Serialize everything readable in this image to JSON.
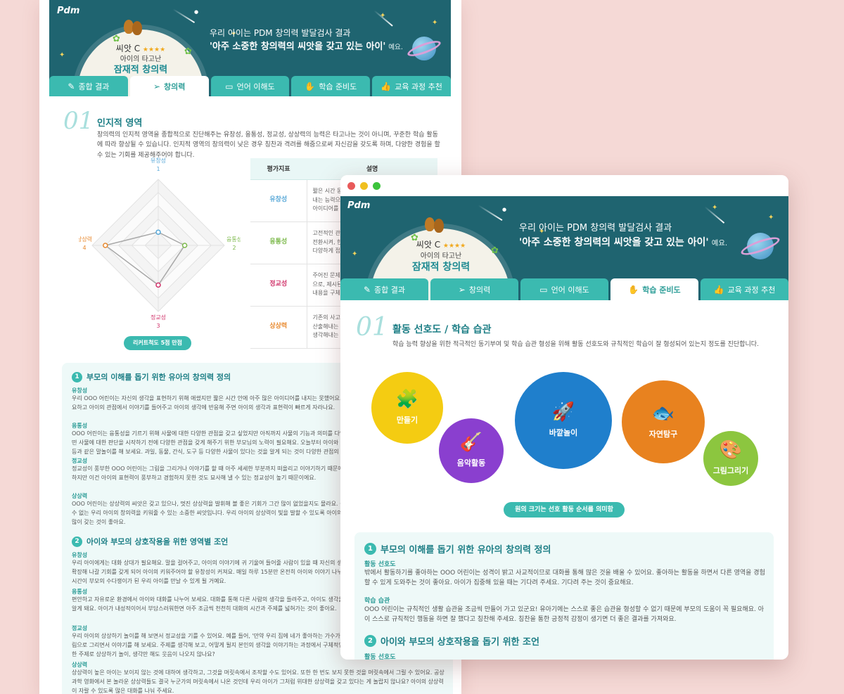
{
  "brand": {
    "logo": "Pdm"
  },
  "colors": {
    "teal_dark": "#1f6470",
    "teal": "#3bbab0",
    "accent": "#1e7f86",
    "bg": "#f5d9d6"
  },
  "banner": {
    "grade": "씨앗 C",
    "stars": "★★★★",
    "grade_sub": "아이의 타고난",
    "grade_main": "잠재적 창의력",
    "line1": "우리 아이는 PDM 창의력 발달검사 결과",
    "line2": "'아주 소중한 창의력의 씨앗을 갖고 있는 아이'",
    "line2_suffix": "예요."
  },
  "tabs": [
    {
      "label": "종합 결과",
      "icon": "edit-icon"
    },
    {
      "label": "창의력",
      "icon": "send-icon"
    },
    {
      "label": "언어 이해도",
      "icon": "chat-icon"
    },
    {
      "label": "학습 준비도",
      "icon": "hand-icon"
    },
    {
      "label": "교육 과정 추천",
      "icon": "thumbs-up-icon"
    }
  ],
  "back": {
    "active_tab": 1,
    "section_num": "01",
    "section_title": "인지적 영역",
    "section_desc": "창의력의 인지적 영역을 종합적으로 진단해주는 유창성, 융통성, 정교성, 상상력의 능력은 타고나는 것이 아니며, 꾸준한 학습 활동에 따라 향상될 수 있습니다. 인지적 영역의 창의력이 낮은 경우 칭찬과 격려를 해줌으로써 자신감을 갖도록 하며, 다양한 경험을 할 수 있는 기회를 제공해주어야 합니다.",
    "radar": {
      "top": {
        "name": "유창성",
        "value": "1"
      },
      "right": {
        "name": "융통성",
        "value": "2"
      },
      "bottom": {
        "name": "정교성",
        "value": "3"
      },
      "left": {
        "name": "상상력",
        "value": "4"
      },
      "scale_max": 5,
      "scores": [
        1,
        2,
        3,
        4
      ]
    },
    "radar_pill": "리커트척도 5점 만점",
    "table": {
      "headers": [
        "평가지표",
        "설명"
      ],
      "rows": [
        {
          "k": "유창성",
          "t": "짧은 시간 동안 가능한 한 많은 아이디어를 산출해내는 능력으로 주제에 맞는 것으로 주제에 관련된 아이디어를 산출해내는 능력"
        },
        {
          "k": "융통성",
          "t": "고전적인 관점에서 벗어나 다양한 방향으로 사고를 전환시켜, 한 가지 방법으로 접근하는 것이 아니라 다양하게 접근하여 아이디어를 산출하는 능력"
        },
        {
          "k": "정교성",
          "t": "주어진 문제를 세밀하게 관찰하여 다듬어 가는 것으로, 제시된 의미를 명확하게 하기 위해 세부적인 내용을 구체화하거나 보완하고 정리하는 능력"
        },
        {
          "k": "상상력",
          "t": "기존의 사고에서 벗어나 새롭고 독특한 아이디어를 산출해내는 능력으로 이전에 경험해보지 못한 것을 생각해내는 능력이나 새로운 것을 만드는 능력"
        }
      ],
      "key_colors": [
        "#5aa9d8",
        "#7cb94b",
        "#d0336a",
        "#e8892e"
      ]
    },
    "advice1": {
      "num": "1",
      "title": "부모의 이해를 돕기 위한 유아의 창의력 정의",
      "items": [
        {
          "h": "유창성",
          "t": "우리 OOO 어린이는 자신의 생각을 표현하기 위해 애썼지만 짧은 시간 안에 아주 많은 아이디어를 내지는 못했어요. 아이가 자신의 생각을 정리하는 시간이 필요하고 아이의 관점에서 이야기를 들어주고 아이의 생각에 반응해 주면 아이의 생각과 표현력이 빠르게 자라나요."
        },
        {
          "h": "융통성",
          "t": "OOO 어린이는 융통성을 기르기 위해 사물에 대한 다양한 관점을 갖고 싶었지만 아직까지 사물의 기능과 의미를 다양하게 생각하는 것이 충분하지 않았어요. 어떤 사물에 대한 판단을 시작하기 전에 다양한 관점을 갖게 해주기 위한 부모님의 노력이 필요해요. 오늘부터 아이와 '동그라미'를 주제로 이야기하며 공, 해, 바퀴 등과 같은 말놀이를 해 보세요. 과일, 동물, 간식, 도구 등 다양한 사물이 있다는 것을 알게 되는 것이 다양한 관점의 시작이에요."
        },
        {
          "h": "정교성",
          "t": "정교성이 풍부한 OOO 어린이는 그림을 그리거나 이야기를 할 때 아주 세세한 부분까지 떠올리고 이야기하기 때문에 다른 사람에게 깊은 인상을 줄 수 있어요. 하지만 이건 아이의 표현력이 풍부하고 경험하지 못한 것도 묘사해 낼 수 있는 정교성이 높기 때문이에요."
        },
        {
          "h": "상상력",
          "t": "OOO 어린이는 상상력의 씨앗은 갖고 있으나, 멋진 상상력을 발휘해 볼 좋은 기회가 그간 많이 없었을지도 몰라요. 상상력은 놀이를 통해 키워줄 수 있는 키울 수 없는 우리 아이의 창의력을 키워줄 수 있는 소중한 씨앗입니다. 우리 아이의 상상력이 빛을 발할 수 있도록 아이의 엉뚱한 이야기들을 재미난 놀이의 시간을 많이 갖는 것이 좋아요."
        }
      ]
    },
    "advice2": {
      "num": "2",
      "title": "아이와 부모의 상호작용을 위한 영역별 조언",
      "items": [
        {
          "h": "유창성",
          "t": "우리 아이에게는 대화 상대가 필요해요. 말을 걸어주고, 아이의 이야기에 귀 기울여 들어줄 사람이 있을 때 자신의 생각을 더 많이 표현하게 돼요. 아이의 생각을 확장해 나갈 기회를 갖게 되어 아이의 키워주어야 할 유창성이 커져요. 매일 하루 15분만 온전히 아이와 이야기 나누는 시간을 가져 보세요. 이야기를 나누는 그 시간이 부모의 수다쟁이가 된 우리 아이를 만날 수 있게 될 거예요."
        },
        {
          "h": "융통성",
          "t": "편안하고 자유로운 환경에서 아이와 대화를 나누어 보세요. 대화를 통해 다른 사람의 생각을 들려주고, 아이도 생각을 표현하면서 서로의 생각이 다를 수 있음을 알게 돼요. 아이가 내성적이어서 부담스러워한면 아주 조금씩 천천히 대화의 시간과 주제를 넓혀가는 것이 좋아요."
        },
        {
          "h": "정교성",
          "t": "우리 아이의 상상하기 놀이를 해 보면서 정교성을 기를 수 있어요. 예를 들어, '만약 우리 집에 네가 좋아하는 가수가 온다면?'과 같이 상상해 보고, 그 상황을 그림으로 그리면서 이야기를 해 보세요. 주제를 생각해 보고, 어떻게 될지 본인의 생각을 이야기하는 과정에서 구체적인 생각과 표현력이 자라요. 아이와 함께 다양한 주제로 상상하기 놀이, 생각만 해도 웃음이 나오지 않나요?"
        },
        {
          "h": "상상력",
          "t": "상상력이 높은 아이는 보이지 않는 것에 대하여 생각하고, 그것을 머릿속에서 조작할 수도 있어요. 또한 한 번도 보지 못한 것을 머릿속에서 그릴 수 있어요. 공상 과학 영화에서 본 놀라운 상상력들도 결국 누군가의 머릿속에서 나온 것인데 우리 아이가 그처럼 위대한 상상력을 갖고 있다는 게 놀랍지 않나요? 아이의 상상력이 자랄 수 있도록 많은 대화를 나눠 주세요."
        }
      ]
    }
  },
  "front": {
    "active_tab": 3,
    "section_num": "01",
    "section_title": "활동 선호도 / 학습 습관",
    "section_desc": "학습 능력 향상을 위한 적극적인 동기부여 및 학습 습관 형성을 위해 활동 선호도와 규칙적인 학습이 잘 형성되어 있는지 정도를 진단합니다.",
    "bubbles": [
      {
        "label": "만들기",
        "icon": "puzzle-icon",
        "color": "#f4cc12"
      },
      {
        "label": "음악활동",
        "icon": "guitar-icon",
        "color": "#8a3fcf"
      },
      {
        "label": "바깥놀이",
        "icon": "rocket-icon",
        "color": "#1f7fcc"
      },
      {
        "label": "자연탐구",
        "icon": "fish-icon",
        "color": "#e8821f"
      },
      {
        "label": "그림그리기",
        "icon": "palette-icon",
        "color": "#8cc63f"
      }
    ],
    "pill": "원의 크기는 선호 활동 순서를 의미함",
    "advice1": {
      "num": "1",
      "title": "부모의 이해를 돕기 위한 유아의 창의력 정의",
      "items": [
        {
          "h": "활동 선호도",
          "t": "밖에서 활동하기를 좋아하는 OOO 어린이는 성격이 밝고 사교적이므로 대화를 통해 많은 것을 배울 수 있어요. 좋아하는 활동을 하면서 다른 영역을 경험할 수 있게 도와주는 것이 좋아요. 아이가 집중해 있을 때는 기다려 주세요. 기다려 주는 것이 중요해요."
        },
        {
          "h": "학습 습관",
          "t": "OOO 어린이는 규칙적인 생활 습관을 조금씩 만들어 가고 있군요! 유아기에는 스스로 좋은 습관을 형성할 수 없기 때문에 부모의 도움이 꼭 필요해요. 아이 스스로 규칙적인 행동을 하면 잘 했다고 칭찬해 주세요. 칭찬을 통한 긍정적 감정이 생기면 더 좋은 결과를 가져와요."
        }
      ]
    },
    "advice2": {
      "num": "2",
      "title": "아이와 부모의 상호작용을 돕기 위한 조언",
      "first_head": "활동 선호도"
    }
  }
}
